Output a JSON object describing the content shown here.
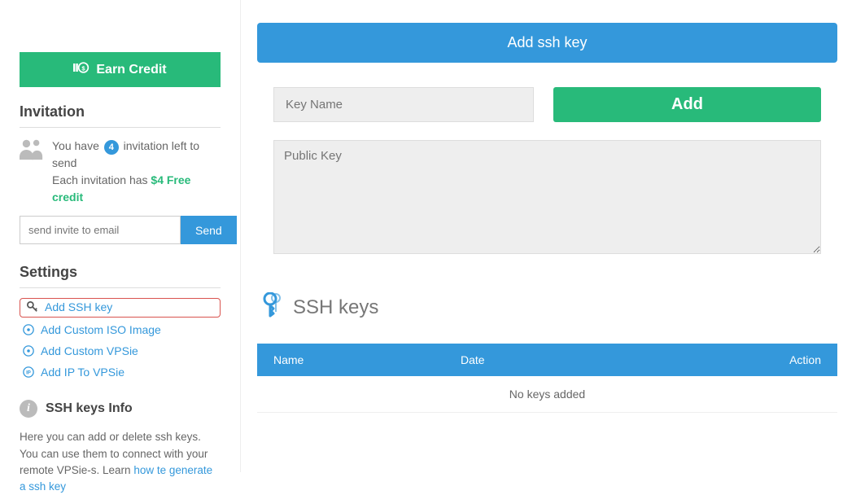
{
  "sidebar": {
    "earn_credit_label": "Earn Credit",
    "invitation_heading": "Invitation",
    "invite_text_prefix": "You have",
    "invite_count": "4",
    "invite_text_suffix": "invitation left to send",
    "invite_line2_prefix": "Each invitation has",
    "invite_free_credit": "$4 Free credit",
    "invite_email_placeholder": "send invite to email",
    "send_label": "Send",
    "settings_heading": "Settings",
    "settings_items": [
      "Add SSH key",
      "Add Custom ISO Image",
      "Add Custom VPSie",
      "Add IP To VPSie"
    ],
    "info_heading": "SSH keys Info",
    "info_body_prefix": "Here you can add or delete ssh keys. You can use them to connect with your remote VPSie-s. Learn ",
    "info_link_text": "how te generate a ssh key"
  },
  "main": {
    "panel_title": "Add ssh key",
    "key_name_placeholder": "Key Name",
    "add_button_label": "Add",
    "public_key_placeholder": "Public Key",
    "keys_heading": "SSH keys",
    "table": {
      "col_name": "Name",
      "col_date": "Date",
      "col_action": "Action",
      "empty_message": "No keys added"
    }
  }
}
